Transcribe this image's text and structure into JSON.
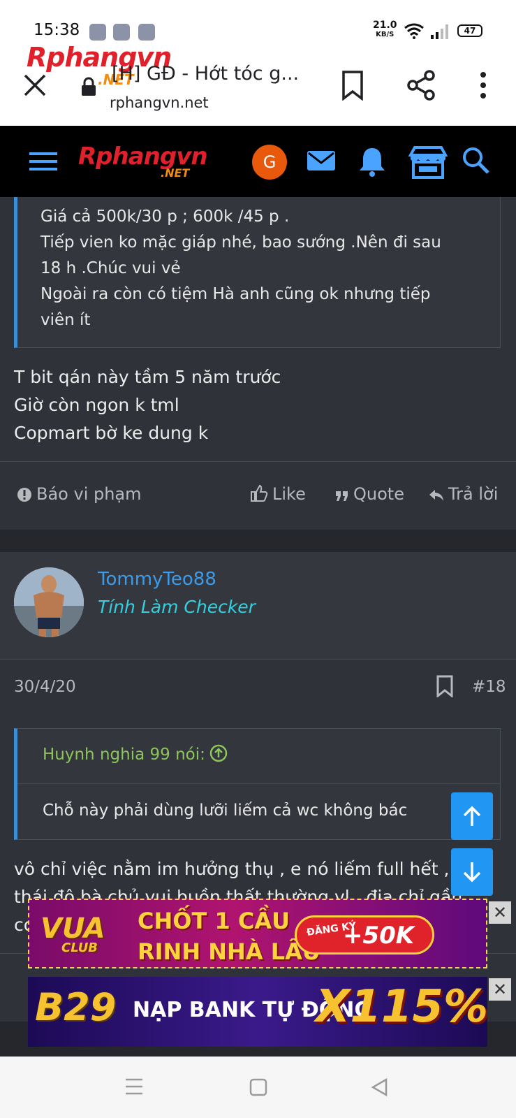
{
  "status_bar": {
    "time": "15:38",
    "net_speed": "21.0",
    "net_unit": "KB/S",
    "battery": "47"
  },
  "browser": {
    "logo_text": "Rphangvn",
    "logo_suffix": ".NET",
    "page_title": "[H] GĐ - Hớt tóc g...",
    "url": "rphangvn.net"
  },
  "site_nav": {
    "logo_text": "Rphangvn",
    "logo_suffix": ".NET",
    "avatar_letter": "G"
  },
  "previous_post": {
    "quote_lines": [
      "Giá cả 500k/30 p ; 600k /45 p .",
      "Tiếp vien ko mặc giáp nhé, bao sướng .Nên đi sau",
      "18 h .Chúc vui vẻ",
      "Ngoài ra còn có tiệm Hà anh cũng ok nhưng tiếp",
      "viên ít"
    ],
    "body_lines": [
      "T bit qán này tầm 5 năm trước",
      "Giờ còn ngon k tml",
      "Copmart bờ ke dung k"
    ]
  },
  "post_actions": {
    "report": "Báo vi phạm",
    "like": "Like",
    "quote": "Quote",
    "reply": "Trả lời"
  },
  "post": {
    "username": "TommyTeo88",
    "user_title": "Tính Làm Checker",
    "date": "30/4/20",
    "number": "#18",
    "quote_author": "Huynh nghia 99 nói:",
    "quote_text": "Chỗ này phải dùng lưỡi liếm cả wc không bác",
    "body_lines": [
      "vô chỉ việc nằm im hưởng thụ , e nó liếm full hết ,",
      "thái độ bà chủ vui buồn thất thường vl , địa chỉ gần",
      "cơ"
    ]
  },
  "ads": {
    "ad1_brand": "VUA",
    "ad1_brand_sub": "CLUB",
    "ad1_line1": "CHỐT 1 CẦU",
    "ad1_line2": "RINH NHÀ LẦU",
    "ad1_badge_small": "ĐĂNG KÝ",
    "ad1_badge_big": "+50K",
    "ad2_brand": "B29",
    "ad2_text": "NẠP BANK TỰ ĐỘNG",
    "ad2_big": "X115%",
    "close_glyph": "✕"
  },
  "colors": {
    "page_bg": "#2f3238",
    "link_blue": "#3d9be9",
    "user_title_cyan": "#35d0e0",
    "quote_green": "#8dc55a",
    "accent_blue": "#2196f3"
  }
}
